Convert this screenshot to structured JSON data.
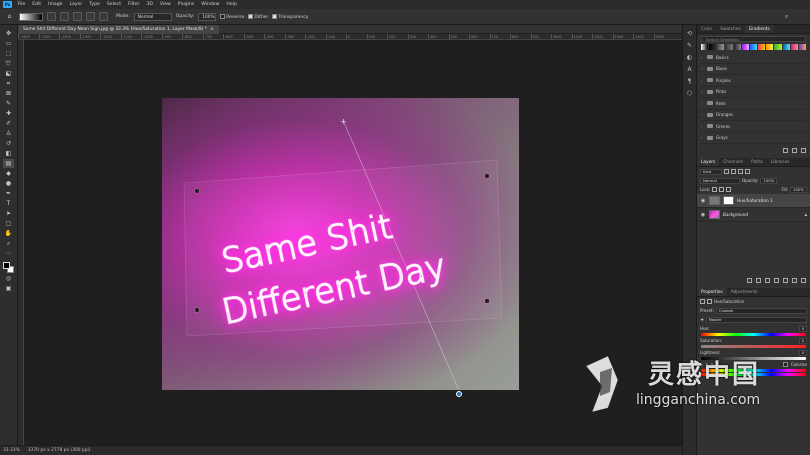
{
  "app": {
    "logo": "Ps"
  },
  "menubar": {
    "items": [
      "File",
      "Edit",
      "Image",
      "Layer",
      "Type",
      "Select",
      "Filter",
      "3D",
      "View",
      "Plugins",
      "Window",
      "Help"
    ]
  },
  "options_bar": {
    "mode_label": "Mode:",
    "mode_value": "Normal",
    "opacity_label": "Opacity:",
    "opacity_value": "100%",
    "reverse_label": "Reverse",
    "dither_label": "Dither",
    "transparency_label": "Transparency"
  },
  "document": {
    "tab_title": "Same Shit Different Day Neon Sign.jpg @ 33.3% (Hue/Saturation 1, Layer Mask/8) *",
    "close": "×"
  },
  "rulers": {
    "top": [
      "-1600",
      "-1500",
      "-1400",
      "-1300",
      "-1200",
      "-1100",
      "-1000",
      "-900",
      "-800",
      "-700",
      "-600",
      "-500",
      "-400",
      "-300",
      "-200",
      "-100",
      "0",
      "100",
      "200",
      "300",
      "400",
      "500",
      "600",
      "700",
      "800",
      "900",
      "1000",
      "1100",
      "1200",
      "1300",
      "1400",
      "1500"
    ]
  },
  "canvas": {
    "neon_line1": "Same Shit",
    "neon_line2": "Different Day",
    "neon_color": "#ff66f0"
  },
  "status": {
    "zoom": "33.33%",
    "doc_info": "3370 px x 2778 px (300 ppi)"
  },
  "gradients_panel": {
    "tabs": [
      "Color",
      "Swatches",
      "Gradients"
    ],
    "active_tab": "Gradients",
    "search_placeholder": "Search Gradients",
    "folders": [
      "Basics",
      "Blues",
      "Purples",
      "Pinks",
      "Reds",
      "Oranges",
      "Greens",
      "Grays"
    ]
  },
  "layers_panel": {
    "tabs": [
      "Layers",
      "Channels",
      "Paths",
      "Libraries"
    ],
    "active_tab": "Layers",
    "filter_label": "Kind",
    "blend_mode": "Normal",
    "opacity_label": "Opacity:",
    "opacity_value": "100%",
    "lock_label": "Lock:",
    "fill_label": "Fill:",
    "fill_value": "100%",
    "layers": [
      {
        "name": "Hue/Saturation 1",
        "selected": true
      },
      {
        "name": "Background",
        "selected": false
      }
    ]
  },
  "properties_panel": {
    "tabs": [
      "Properties",
      "Adjustments"
    ],
    "active_tab": "Properties",
    "title": "Hue/Saturation",
    "preset_label": "Preset:",
    "preset_value": "Custom",
    "channel_value": "Master",
    "hue_label": "Hue:",
    "hue_value": "0",
    "saturation_label": "Saturation:",
    "saturation_value": "0",
    "lightness_label": "Lightness:",
    "lightness_value": "0",
    "colorize_label": "Colorize"
  },
  "watermark": {
    "cn": "灵感中国",
    "en": "lingganchina.com"
  }
}
